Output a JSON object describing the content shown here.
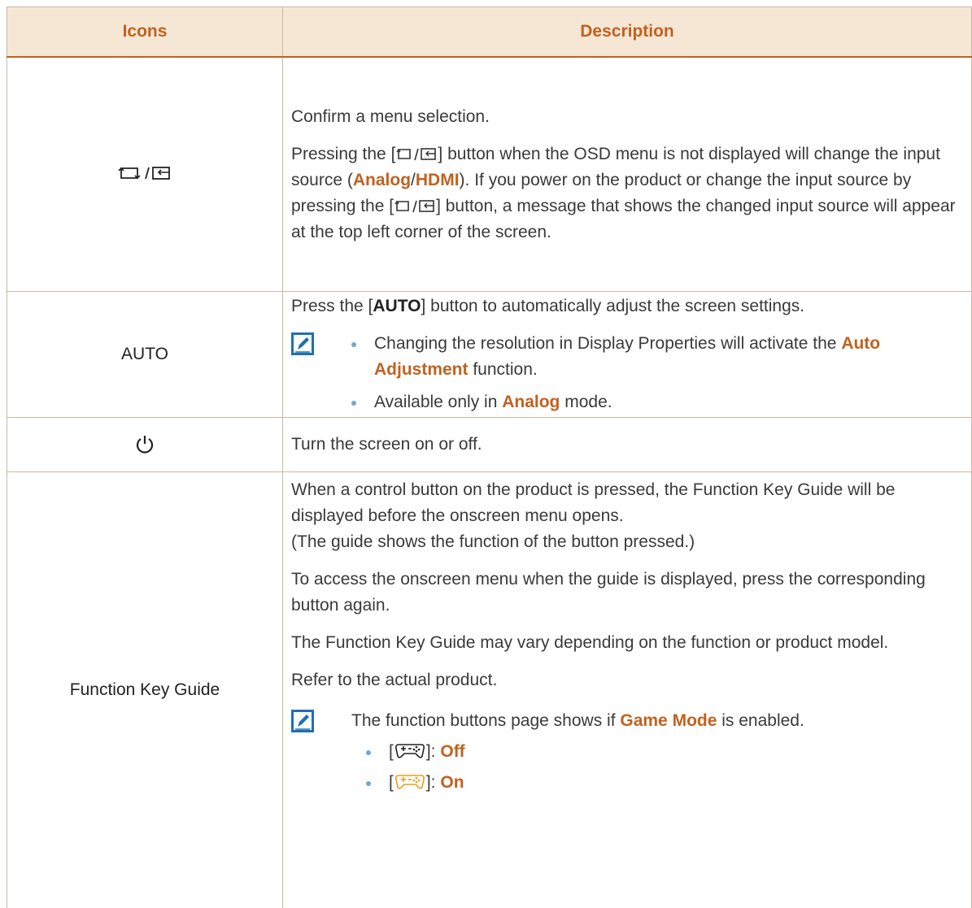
{
  "colors": {
    "accent": "#c2611f",
    "header_bg": "#f6e7d4",
    "bullet": "#6fa6d6",
    "note_icon": "#1f6fb5"
  },
  "header": {
    "icons": "Icons",
    "description": "Description"
  },
  "row_source": {
    "icon_names": [
      "source-icon",
      "enter-icon"
    ],
    "p1": "Confirm a menu selection.",
    "p2_a": "Pressing the [",
    "p2_b": "] button when the OSD menu is not displayed will change the input source (",
    "analog": "Analog",
    "slash": "/",
    "hdmi": "HDMI",
    "p2_c": "). If you power on the product or change the input source by pressing the [",
    "p2_d": "] button, a message that shows the changed input source will appear at the top left corner of the screen."
  },
  "row_auto": {
    "icon_label": "AUTO",
    "p1_a": "Press the [",
    "p1_b": "AUTO",
    "p1_c": "] button to automatically adjust the screen settings.",
    "b1_a": "Changing the resolution in Display Properties will activate the ",
    "b1_hl": "Auto Adjustment",
    "b1_b": " function.",
    "b2_a": "Available only in ",
    "b2_hl": "Analog",
    "b2_b": " mode."
  },
  "row_power": {
    "icon_name": "power-icon",
    "text": "Turn the screen on or off."
  },
  "row_guide": {
    "icon_label": "Function Key Guide",
    "p1": "When a control button on the product is pressed, the Function Key Guide will be displayed before the onscreen menu opens.",
    "p1b": "(The guide shows the function of the button pressed.)",
    "p2": "To access the onscreen menu when the guide is displayed, press the corresponding button again.",
    "p3": "The Function Key Guide may vary depending on the function or product model.",
    "p4": "Refer to the actual product.",
    "note_a": "The function buttons page shows if ",
    "note_hl": "Game Mode",
    "note_b": " is enabled.",
    "b_off_open": "[",
    "b_off_close": "]: ",
    "b_off": "Off",
    "b_on_open": "[",
    "b_on_close": "]: ",
    "b_on": "On"
  }
}
